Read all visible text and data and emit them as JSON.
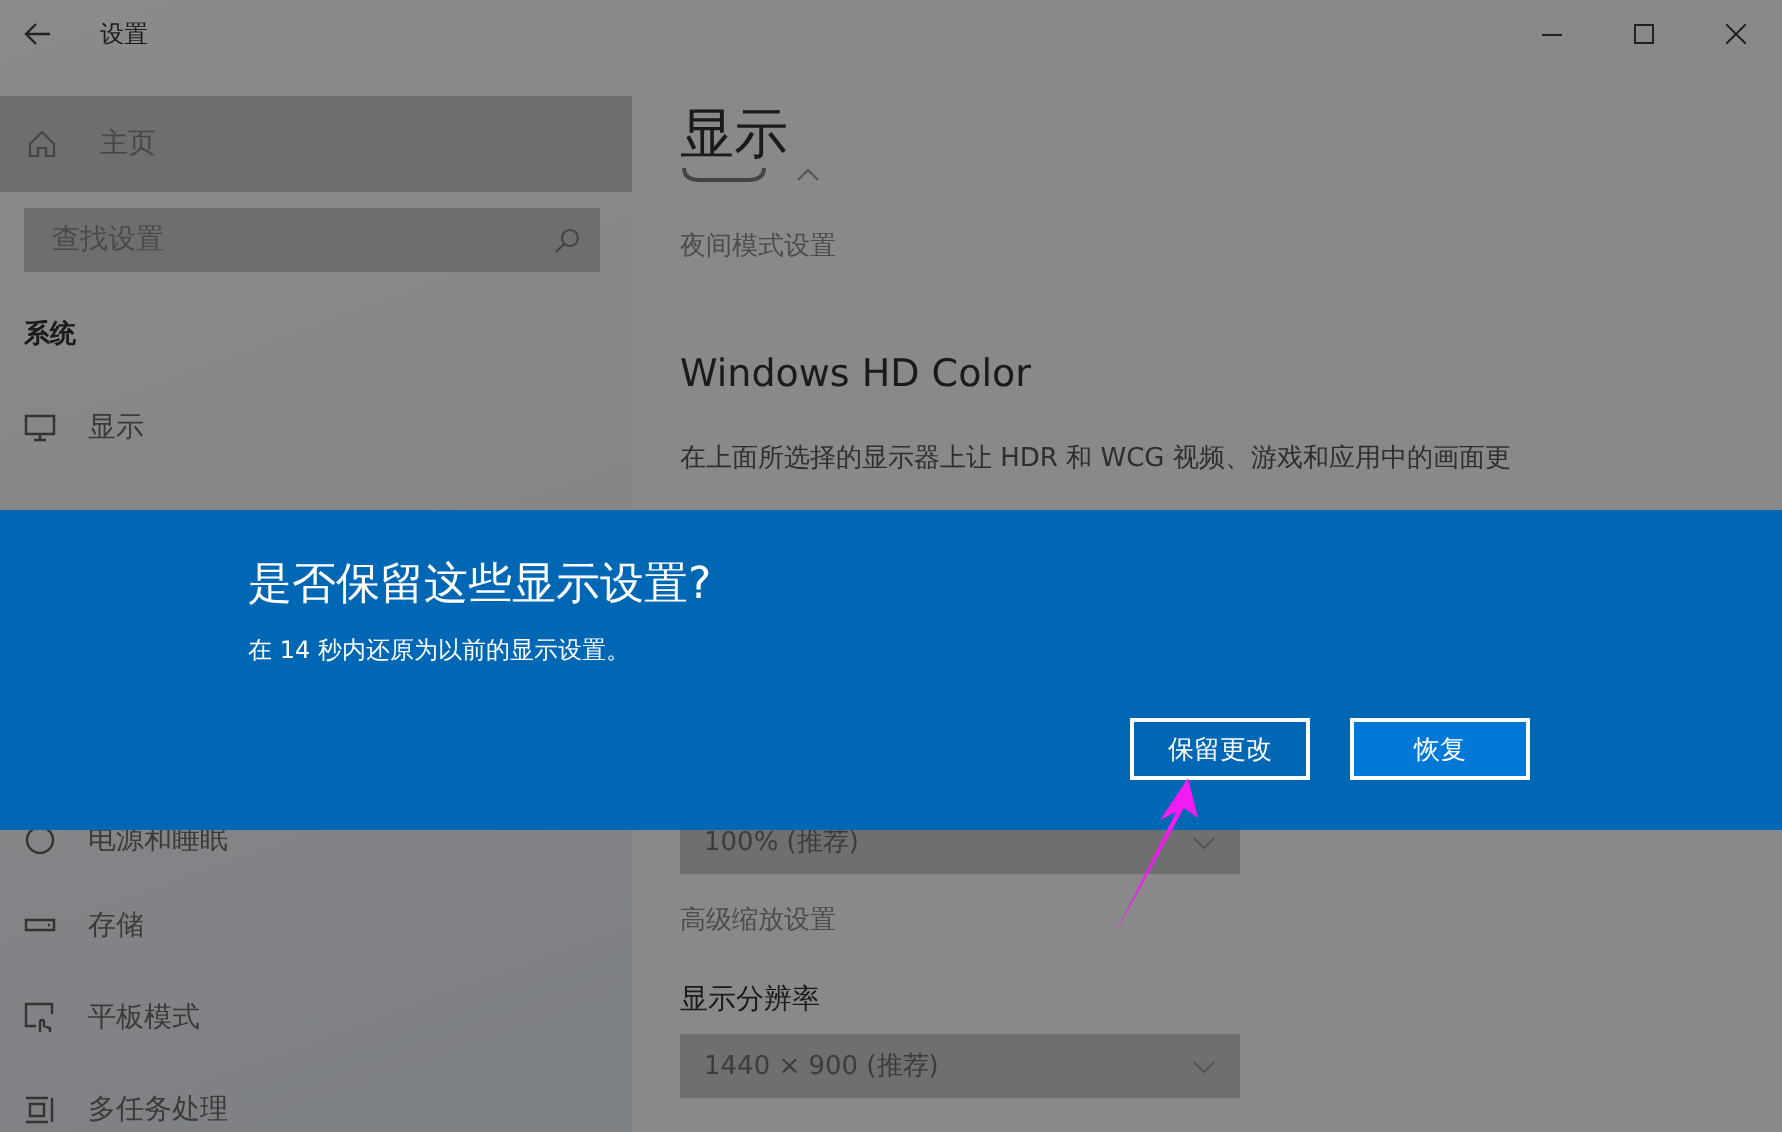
{
  "window": {
    "title": "设置"
  },
  "sidebar": {
    "home": {
      "label": "主页"
    },
    "search": {
      "placeholder": "查找设置"
    },
    "section": "系统",
    "items": [
      {
        "label": "显示",
        "kind": "monitor"
      },
      {
        "label": "电源和睡眠",
        "kind": "power"
      },
      {
        "label": "存储",
        "kind": "storage"
      },
      {
        "label": "平板模式",
        "kind": "tablet"
      },
      {
        "label": "多任务处理",
        "kind": "multitask"
      }
    ]
  },
  "main": {
    "title": "显示",
    "night_light_link": "夜间模式设置",
    "hd_color": {
      "heading": "Windows HD Color",
      "description": "在上面所选择的显示器上让 HDR 和 WCG 视频、游戏和应用中的画面更"
    },
    "scale_dropdown": {
      "value": "100% (推荐)"
    },
    "advanced_scaling_link": "高级缩放设置",
    "resolution": {
      "label": "显示分辨率",
      "value": "1440 × 900 (推荐)"
    }
  },
  "dialog": {
    "title": "是否保留这些显示设置?",
    "message": "在 14 秒内还原为以前的显示设置。",
    "buttons": [
      {
        "label": "保留更改",
        "kind": "outlined"
      },
      {
        "label": "恢复",
        "kind": "filled"
      }
    ]
  }
}
